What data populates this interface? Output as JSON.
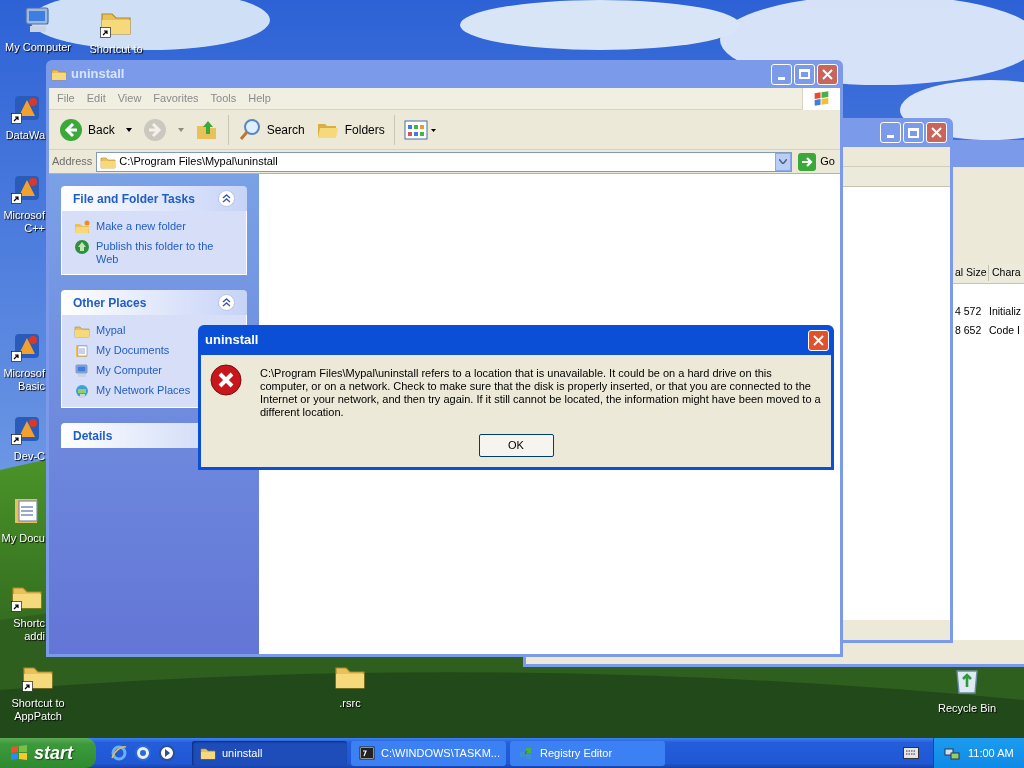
{
  "desktop": {
    "icons": [
      {
        "kind": "computer",
        "shortcut": false,
        "label": [
          "My Computer"
        ]
      },
      {
        "kind": "folder",
        "shortcut": true,
        "label": [
          "Shortcut to"
        ]
      },
      {
        "kind": "app",
        "shortcut": true,
        "label": [
          "DataWa"
        ]
      },
      {
        "kind": "app",
        "shortcut": true,
        "label": [
          "Microsof",
          "C++"
        ]
      },
      {
        "kind": "app",
        "shortcut": true,
        "label": [
          "Microsof",
          "Basic"
        ]
      },
      {
        "kind": "app",
        "shortcut": true,
        "label": [
          "Dev-C"
        ]
      },
      {
        "kind": "documents",
        "shortcut": false,
        "label": [
          "My Docu"
        ]
      },
      {
        "kind": "folder",
        "shortcut": true,
        "label": [
          "Shortc",
          "addi"
        ]
      },
      {
        "kind": "folder",
        "shortcut": true,
        "label": [
          "Shortcut to",
          "AppPatch"
        ]
      },
      {
        "kind": "folder",
        "shortcut": false,
        "label": [
          ".rsrc"
        ]
      },
      {
        "kind": "recycle",
        "shortcut": false,
        "label": [
          "Recycle Bin"
        ]
      }
    ]
  },
  "back_window": {
    "columns": [
      "al Size",
      "Chara"
    ],
    "rows": [
      [
        "4 572",
        "Initializ"
      ],
      [
        "8 652",
        "Code I"
      ]
    ]
  },
  "explorer": {
    "title": "uninstall",
    "menu": [
      "File",
      "Edit",
      "View",
      "Favorites",
      "Tools",
      "Help"
    ],
    "toolbar": [
      {
        "kind": "back",
        "label": "Back",
        "disabled": false
      },
      {
        "kind": "forward",
        "disabled": true
      },
      {
        "kind": "up",
        "disabled": false
      },
      {
        "kind": "search",
        "label": "Search",
        "disabled": false
      },
      {
        "kind": "folders",
        "label": "Folders",
        "disabled": false
      },
      {
        "kind": "views",
        "disabled": false
      }
    ],
    "address": {
      "label": "Address",
      "value": "C:\\Program Files\\Mypal\\uninstall",
      "go": "Go"
    },
    "panels": [
      {
        "title": "File and Folder Tasks",
        "expanded": true,
        "items": [
          {
            "label": "Make a new folder"
          },
          {
            "label": "Publish this folder to the Web"
          }
        ]
      },
      {
        "title": "Other Places",
        "expanded": true,
        "items": [
          {
            "label": "Mypal"
          },
          {
            "label": "My Documents"
          },
          {
            "label": "My Computer"
          },
          {
            "label": "My Network Places"
          }
        ]
      },
      {
        "title": "Details"
      }
    ]
  },
  "dialog": {
    "title": "uninstall",
    "message": "C:\\Program Files\\Mypal\\uninstall refers to a location that is unavailable. It could be on a hard drive on this computer, or on a network. Check to make sure that the disk is properly inserted, or that you are connected to the Internet or your network, and then try again. If it still cannot be located, the information might have been moved to a different location.",
    "button": "OK"
  },
  "taskbar": {
    "start": "start",
    "tasks": [
      {
        "label": "uninstall",
        "selected": true
      },
      {
        "label": "C:\\WINDOWS\\TASKM...",
        "selected": false
      },
      {
        "label": "Registry Editor",
        "selected": false
      }
    ],
    "clock": "11:00 AM"
  }
}
